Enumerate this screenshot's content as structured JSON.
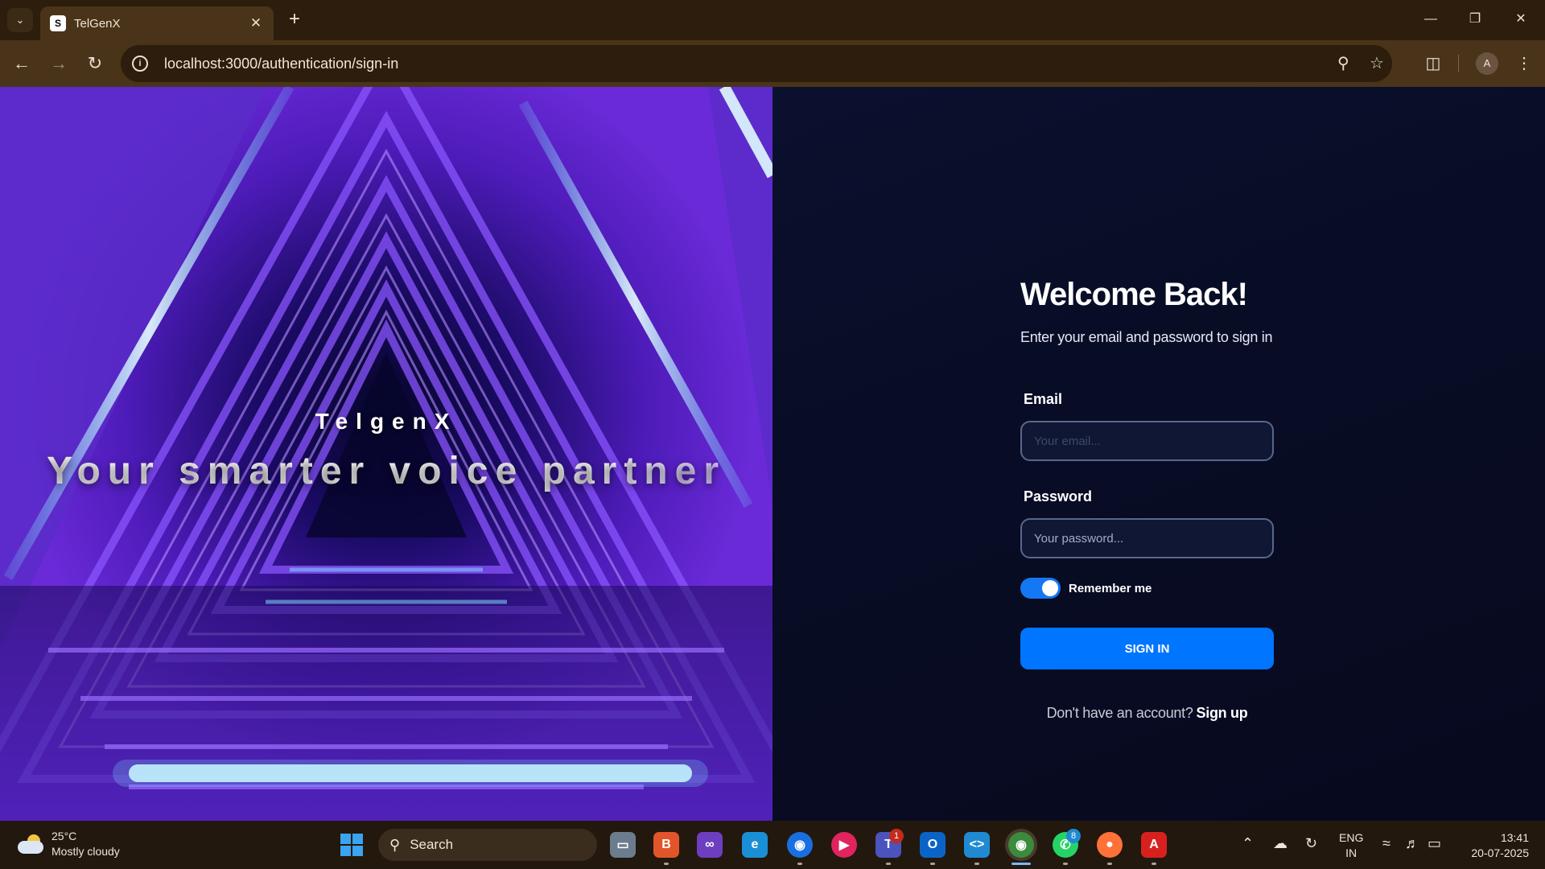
{
  "browser": {
    "tab_title": "TelGenX",
    "tab_favicon": "S",
    "url": "localhost:3000/authentication/sign-in",
    "profile_initial": "A"
  },
  "hero": {
    "brand": "TelgenX",
    "tagline": "Your smarter voice partner"
  },
  "form": {
    "title": "Welcome Back!",
    "subtitle": "Enter your email and password to sign in",
    "email_label": "Email",
    "email_placeholder": "Your email...",
    "email_value": "",
    "password_label": "Password",
    "password_placeholder": "Your password...",
    "password_value": "",
    "remember_label": "Remember me",
    "remember_on": true,
    "signin_label": "SIGN IN",
    "signup_prompt": "Don't have an account?",
    "signup_link": "Sign up"
  },
  "taskbar": {
    "weather_temp": "25°C",
    "weather_desc": "Mostly cloudy",
    "search_label": "Search",
    "teams_badge": "1",
    "whatsapp_badge": "8",
    "lang_top": "ENG",
    "lang_bottom": "IN",
    "time": "13:41",
    "date": "20-07-2025"
  },
  "colors": {
    "accent_blue": "#0075ff",
    "page_bg": "#0a1030",
    "browser_frame": "#4a3419"
  }
}
